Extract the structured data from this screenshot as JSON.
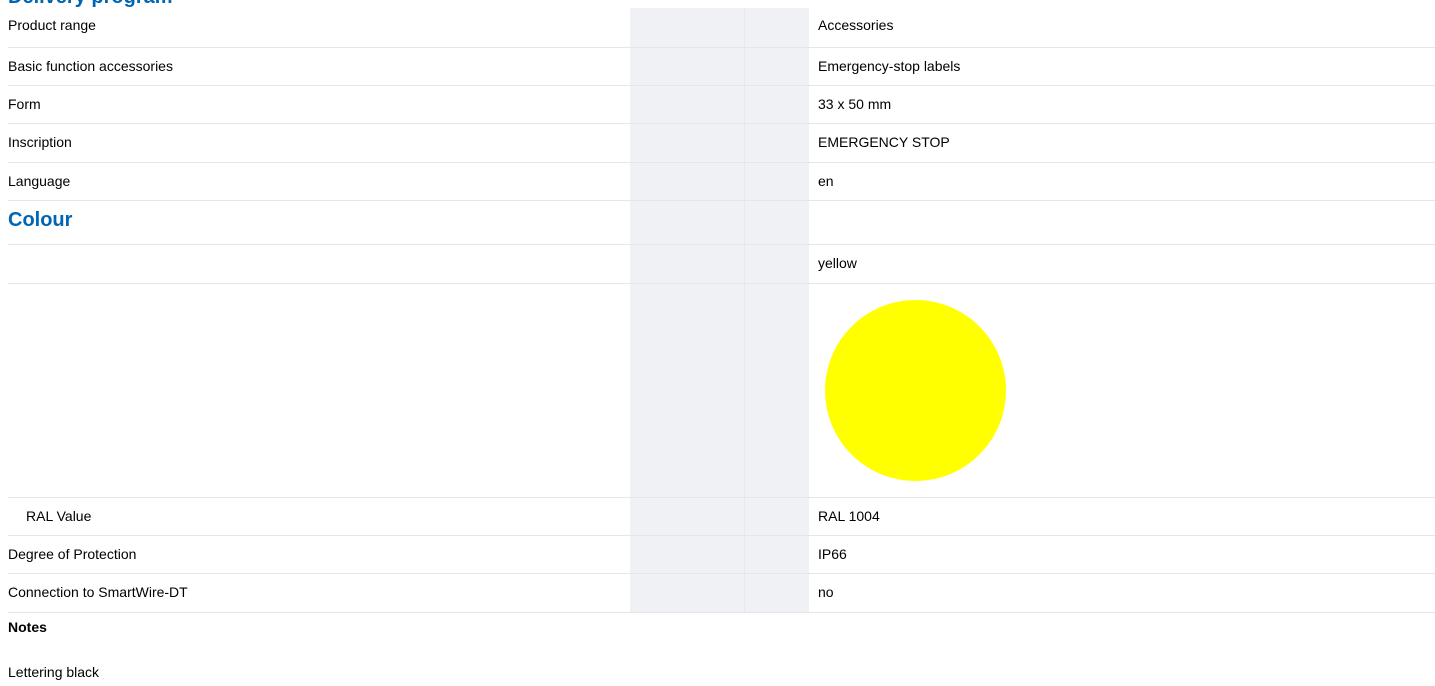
{
  "section_title": "Delivery program",
  "rows": [
    {
      "label": "Product range",
      "value": "Accessories"
    },
    {
      "label": "Basic function accessories",
      "value": "Emergency-stop labels"
    },
    {
      "label": "Form",
      "value": "33 x 50 mm"
    },
    {
      "label": "Inscription",
      "value": "EMERGENCY STOP"
    },
    {
      "label": "Language",
      "value": "en"
    }
  ],
  "colour": {
    "heading": "Colour",
    "name": "yellow",
    "swatch_color": "#ffff00",
    "ral_label": "RAL Value",
    "ral_value": "RAL 1004"
  },
  "rows2": [
    {
      "label": "Degree of Protection",
      "value": "IP66"
    },
    {
      "label": "Connection to SmartWire-DT",
      "value": "no"
    }
  ],
  "notes": {
    "title": "Notes",
    "text": "Lettering black"
  }
}
